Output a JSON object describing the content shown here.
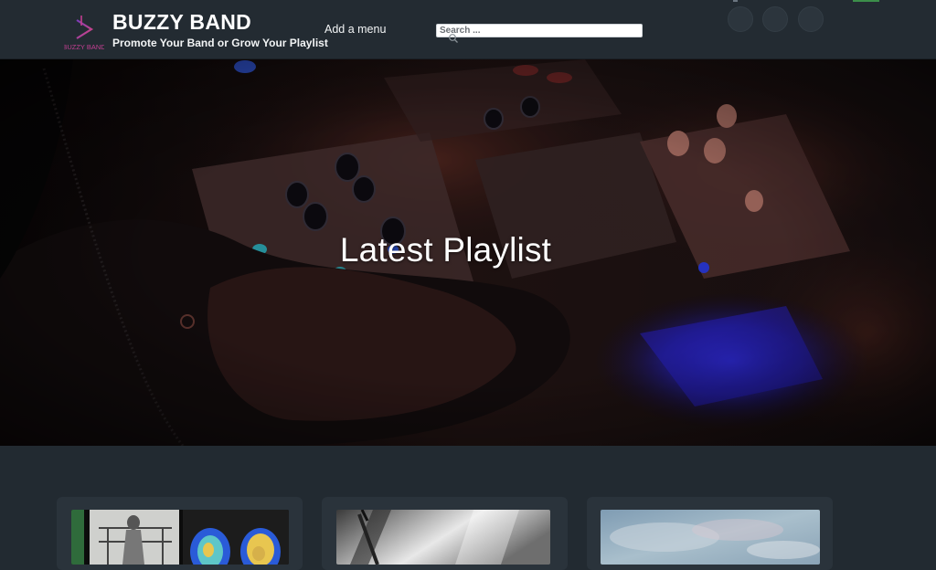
{
  "site": {
    "title": "BUZZY BAND",
    "tagline": "Promote Your Band or Grow Your Playlist",
    "logo_text": "BUZZY BAND"
  },
  "nav": {
    "menu_label": "Add a menu"
  },
  "search": {
    "placeholder": "Search ..."
  },
  "social_icons": [
    "social-icon-1",
    "social-icon-2",
    "social-icon-3"
  ],
  "hero": {
    "title": "Latest Playlist"
  },
  "cards": [
    {
      "name": "playlist-card-1"
    },
    {
      "name": "playlist-card-2"
    },
    {
      "name": "playlist-card-3"
    }
  ],
  "colors": {
    "header_bg": "#232b32",
    "page_bg": "#222a31",
    "card_bg": "#2a333b",
    "logo_accent": "#c23f92"
  }
}
